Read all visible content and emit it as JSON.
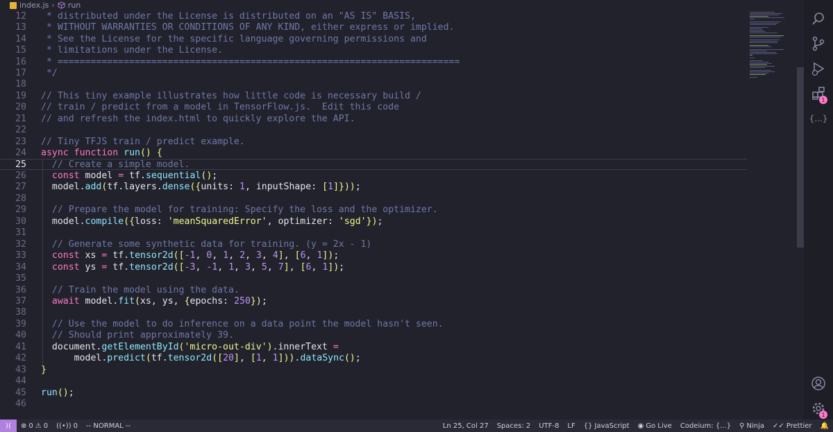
{
  "breadcrumb": {
    "file": "index.js",
    "symbol": "run"
  },
  "editor": {
    "current_line": 25,
    "lines": [
      {
        "n": "12",
        "t": " * distributed under the License is distributed on an \"AS IS\" BASIS,"
      },
      {
        "n": "13",
        "t": " * WITHOUT WARRANTIES OR CONDITIONS OF ANY KIND, either express or implied."
      },
      {
        "n": "14",
        "t": " * See the License for the specific language governing permissions and"
      },
      {
        "n": "15",
        "t": " * limitations under the License."
      },
      {
        "n": "16",
        "t": " * ========================================================================="
      },
      {
        "n": "17",
        "t": " */"
      },
      {
        "n": "18",
        "t": ""
      },
      {
        "n": "19",
        "t": "// This tiny example illustrates how little code is necessary build /"
      },
      {
        "n": "20",
        "t": "// train / predict from a model in TensorFlow.js.  Edit this code"
      },
      {
        "n": "21",
        "t": "// and refresh the index.html to quickly explore the API."
      },
      {
        "n": "22",
        "t": ""
      },
      {
        "n": "23",
        "t": "// Tiny TFJS train / predict example."
      },
      {
        "n": "24",
        "t": "async function run() {"
      },
      {
        "n": "25",
        "t": "  // Create a simple model."
      },
      {
        "n": "26",
        "t": "  const model = tf.sequential();"
      },
      {
        "n": "27",
        "t": "  model.add(tf.layers.dense({units: 1, inputShape: [1]}));"
      },
      {
        "n": "28",
        "t": ""
      },
      {
        "n": "29",
        "t": "  // Prepare the model for training: Specify the loss and the optimizer."
      },
      {
        "n": "30",
        "t": "  model.compile({loss: 'meanSquaredError', optimizer: 'sgd'});"
      },
      {
        "n": "31",
        "t": ""
      },
      {
        "n": "32",
        "t": "  // Generate some synthetic data for training. (y = 2x - 1)"
      },
      {
        "n": "33",
        "t": "  const xs = tf.tensor2d([-1, 0, 1, 2, 3, 4], [6, 1]);"
      },
      {
        "n": "34",
        "t": "  const ys = tf.tensor2d([-3, -1, 1, 3, 5, 7], [6, 1]);"
      },
      {
        "n": "35",
        "t": ""
      },
      {
        "n": "36",
        "t": "  // Train the model using the data."
      },
      {
        "n": "37",
        "t": "  await model.fit(xs, ys, {epochs: 250});"
      },
      {
        "n": "38",
        "t": ""
      },
      {
        "n": "39",
        "t": "  // Use the model to do inference on a data point the model hasn't seen."
      },
      {
        "n": "40",
        "t": "  // Should print approximately 39."
      },
      {
        "n": "41",
        "t": "  document.getElementById('micro-out-div').innerText ="
      },
      {
        "n": "42",
        "t": "      model.predict(tf.tensor2d([20], [1, 1])).dataSync();"
      },
      {
        "n": "43",
        "t": "}"
      },
      {
        "n": "44",
        "t": ""
      },
      {
        "n": "45",
        "t": "run();"
      },
      {
        "n": "46",
        "t": ""
      }
    ]
  },
  "activity_bar": {
    "search_icon": "search-icon",
    "scm_icon": "source-control-icon",
    "run_icon": "run-debug-icon",
    "extensions_icon": "extensions-icon",
    "extensions_badge": "1",
    "json_label": "{...}",
    "account_icon": "account-icon",
    "settings_icon": "gear-icon",
    "settings_badge": "1"
  },
  "status": {
    "errors": "0",
    "warnings": "0",
    "ports": "0",
    "mode": "-- NORMAL --",
    "position": "Ln 25, Col 27",
    "spaces": "Spaces: 2",
    "encoding": "UTF-8",
    "eol": "LF",
    "language": "JavaScript",
    "go_live": "Go Live",
    "codeium": "Codeium: {...}",
    "ninja": "Ninja",
    "prettier": "Prettier"
  }
}
